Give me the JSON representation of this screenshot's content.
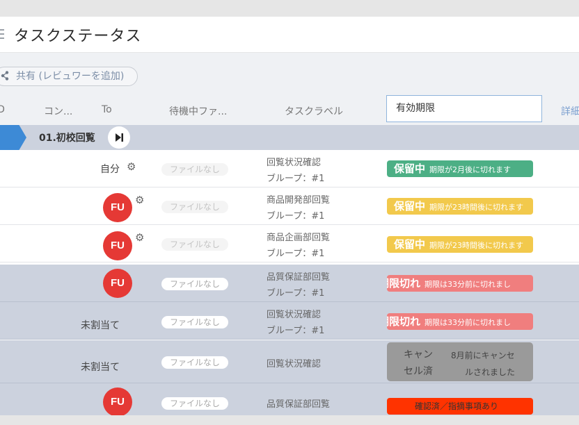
{
  "page": {
    "title": "タスクステータス"
  },
  "toolbar": {
    "share_label": "共有 (レビュワーを追加)"
  },
  "columns": {
    "c0": "ID",
    "content": "コン...",
    "to": "To",
    "waiting_file": "待機中ファ...",
    "task_label": "タスクラベル",
    "expiry": "有効期限",
    "detail": "詳細"
  },
  "group": {
    "name": "01.初校回覧"
  },
  "rows": [
    {
      "assignee": "自分",
      "file": "ファイルなし",
      "label1": "回覧状況確認",
      "label2": "ブループ：#1",
      "status_main": "保留中",
      "status_sub": "期限が2月後に切れます"
    },
    {
      "avatar": "FU",
      "file": "ファイルなし",
      "label1": "商品開発部回覧",
      "label2": "ブループ：#1",
      "status_main": "保留中",
      "status_sub": "期限が23時間後に切れます"
    },
    {
      "avatar": "FU",
      "file": "ファイルなし",
      "label1": "商品企画部回覧",
      "label2": "ブループ：#1",
      "status_main": "保留中",
      "status_sub": "期限が23時間後に切れます"
    },
    {
      "avatar": "FU",
      "file": "ファイルなし",
      "label1": "品質保証部回覧",
      "label2": "ブループ：#1",
      "status_main": "期限切れ",
      "status_sub": "期限は33分前に切れまし"
    },
    {
      "assignee": "未割当て",
      "file": "ファイルなし",
      "label1": "回覧状況確認",
      "label2": "ブループ：#1",
      "status_main": "期限切れ",
      "status_sub": "期限は33分前に切れまし"
    },
    {
      "assignee": "未割当て",
      "file": "ファイルなし",
      "label1": "回覧状況確認",
      "status_line1a": "キャン",
      "status_line1b": "8月前にキャンセ",
      "status_line2a": "セル済",
      "status_line2b": "ルされました"
    },
    {
      "avatar": "FU",
      "file": "ファイルなし",
      "label1": "品質保証部回覧",
      "status_main": "確認済／指摘事項あり"
    }
  ],
  "colors": {
    "accent_blue": "#3d8ad6",
    "avatar_red": "#e53935",
    "status_green": "#4caf85",
    "status_yellow": "#f2c94c",
    "status_red": "#f07e7e",
    "status_gray": "#9a9a9a",
    "status_orange": "#ff3300"
  },
  "icons": [
    "menu-icon",
    "share-icon",
    "skip-next-icon",
    "gear-icon"
  ]
}
